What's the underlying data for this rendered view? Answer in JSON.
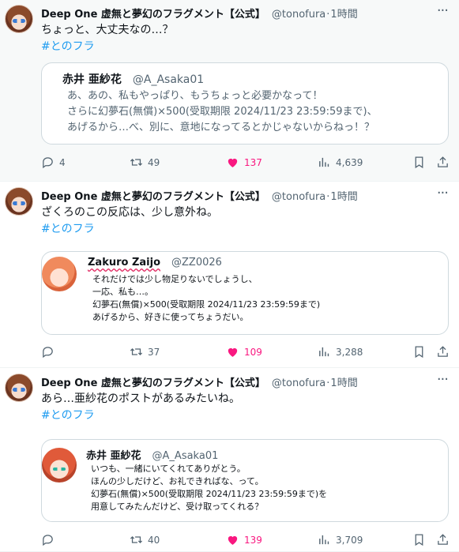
{
  "tweets": [
    {
      "author": "Deep One 虚無と夢幻のフラグメント【公式】",
      "handle": "@tonofura",
      "time": "1時間",
      "text": "ちょっと、大丈夫なの…？",
      "hashtag": "#とのフラ",
      "quote": {
        "name": "赤井 亜紗花",
        "handle": "@A_Asaka01",
        "lines": [
          "あ、あの、私もやっぱり、もうちょっと必要かなって！",
          "さらに幻夢石(無償)×500(受取期限 2024/11/23 23:59:59まで)、",
          "あげるから…べ、別に、意地になってるとかじゃないからねっ！？"
        ]
      },
      "stats": {
        "replies": "4",
        "retweets": "49",
        "likes": "137",
        "views": "4,639"
      }
    },
    {
      "author": "Deep One 虚無と夢幻のフラグメント【公式】",
      "handle": "@tonofura",
      "time": "1時間",
      "text": "ざくろのこの反応は、少し意外ね。",
      "hashtag": "#とのフラ",
      "quote": {
        "name": "Zakuro Zaijo",
        "handle": "@ZZ0026",
        "lines": [
          "それだけでは少し物足りないでしょうし、",
          "一応、私も…。",
          "幻夢石(無償)×500(受取期限 2024/11/23 23:59:59まで)",
          "あげるから、好きに使ってちょうだい。"
        ]
      },
      "stats": {
        "replies": "",
        "retweets": "37",
        "likes": "109",
        "views": "3,288"
      }
    },
    {
      "author": "Deep One 虚無と夢幻のフラグメント【公式】",
      "handle": "@tonofura",
      "time": "1時間",
      "text": "あら…亜紗花のポストがあるみたいね。",
      "hashtag": "#とのフラ",
      "quote": {
        "name": "赤井 亜紗花",
        "handle": "@A_Asaka01",
        "lines": [
          "いつも、一緒にいてくれてありがとう。",
          "ほんの少しだけど、お礼できればな、って。",
          "幻夢石(無償)×500(受取期限 2024/11/23 23:59:59まで)を",
          "用意してみたんだけど、受け取ってくれる？"
        ]
      },
      "stats": {
        "replies": "",
        "retweets": "40",
        "likes": "139",
        "views": "3,709"
      }
    }
  ],
  "colors": {
    "link": "#1d9bf0",
    "like": "#f91880",
    "muted": "#536471",
    "border": "#cfd9de"
  },
  "icons": [
    "more-icon",
    "reply-icon",
    "retweet-icon",
    "heart-icon",
    "views-icon",
    "bookmark-icon",
    "share-icon"
  ]
}
